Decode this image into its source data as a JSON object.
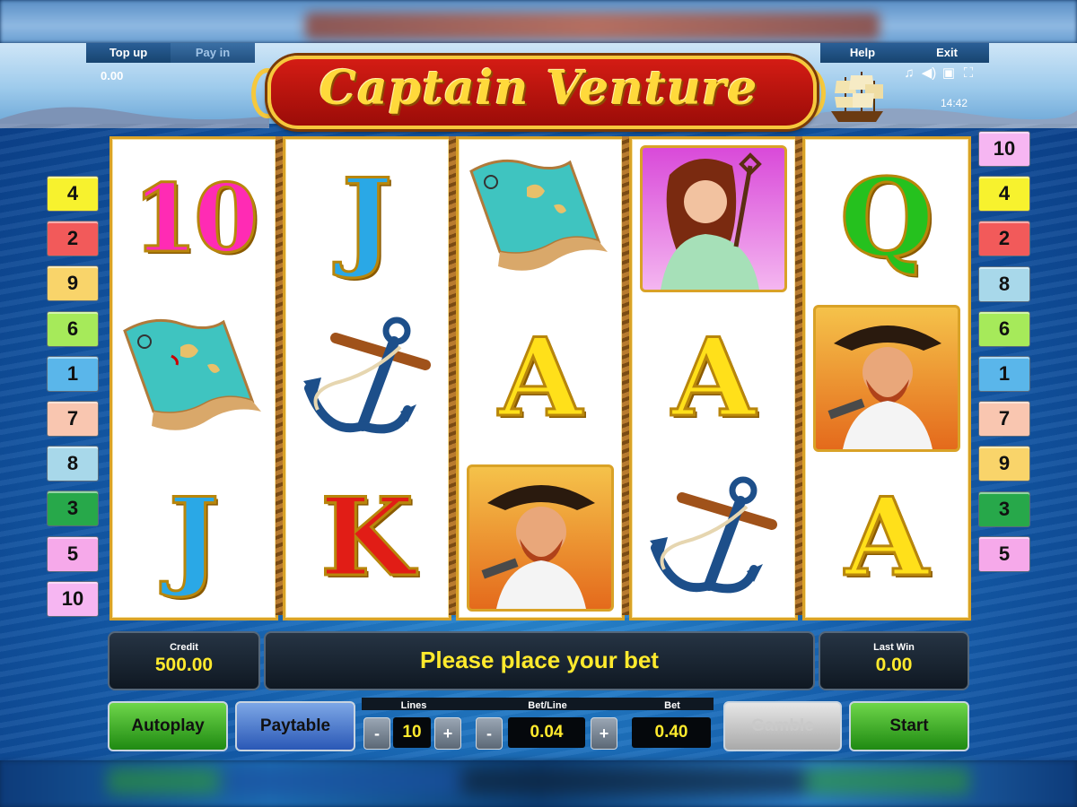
{
  "top_bar": {
    "top_up_label": "Top up",
    "pay_in_label": "Pay in",
    "balance": "0.00",
    "help_label": "Help",
    "exit_label": "Exit",
    "clock": "14:42",
    "icons": [
      "music-icon",
      "sound-icon",
      "window-icon",
      "fullscreen-icon"
    ]
  },
  "game": {
    "title": "Captain Venture"
  },
  "lines_left": [
    "4",
    "2",
    "9",
    "6",
    "1",
    "7",
    "8",
    "3",
    "5",
    "10"
  ],
  "lines_right": [
    "10",
    "4",
    "2",
    "8",
    "6",
    "1",
    "7",
    "9",
    "3",
    "5"
  ],
  "line_colors": {
    "1": "#5ab6ea",
    "2": "#f25a5a",
    "3": "#27a84a",
    "4": "#f7f22e",
    "5": "#f6a9ea",
    "6": "#a6ea5a",
    "7": "#f9c6b0",
    "8": "#a8d8ea",
    "9": "#f9d46a",
    "10": "#f6b6f2"
  },
  "reels": [
    [
      "10",
      "treasure-map",
      "J"
    ],
    [
      "J",
      "anchor",
      "K"
    ],
    [
      "treasure-map",
      "A",
      "captain"
    ],
    [
      "lady",
      "A",
      "anchor"
    ],
    [
      "Q",
      "captain",
      "A"
    ]
  ],
  "panel": {
    "credit_label": "Credit",
    "credit_value": "500.00",
    "message": "Please place your bet",
    "last_win_label": "Last Win",
    "last_win_value": "0.00"
  },
  "controls": {
    "autoplay_label": "Autoplay",
    "paytable_label": "Paytable",
    "lines_label": "Lines",
    "lines_value": "10",
    "bet_line_label": "Bet/Line",
    "bet_line_value": "0.04",
    "bet_label": "Bet",
    "bet_value": "0.40",
    "gamble_label": "Gamble",
    "start_label": "Start",
    "minus": "-",
    "plus": "+"
  }
}
